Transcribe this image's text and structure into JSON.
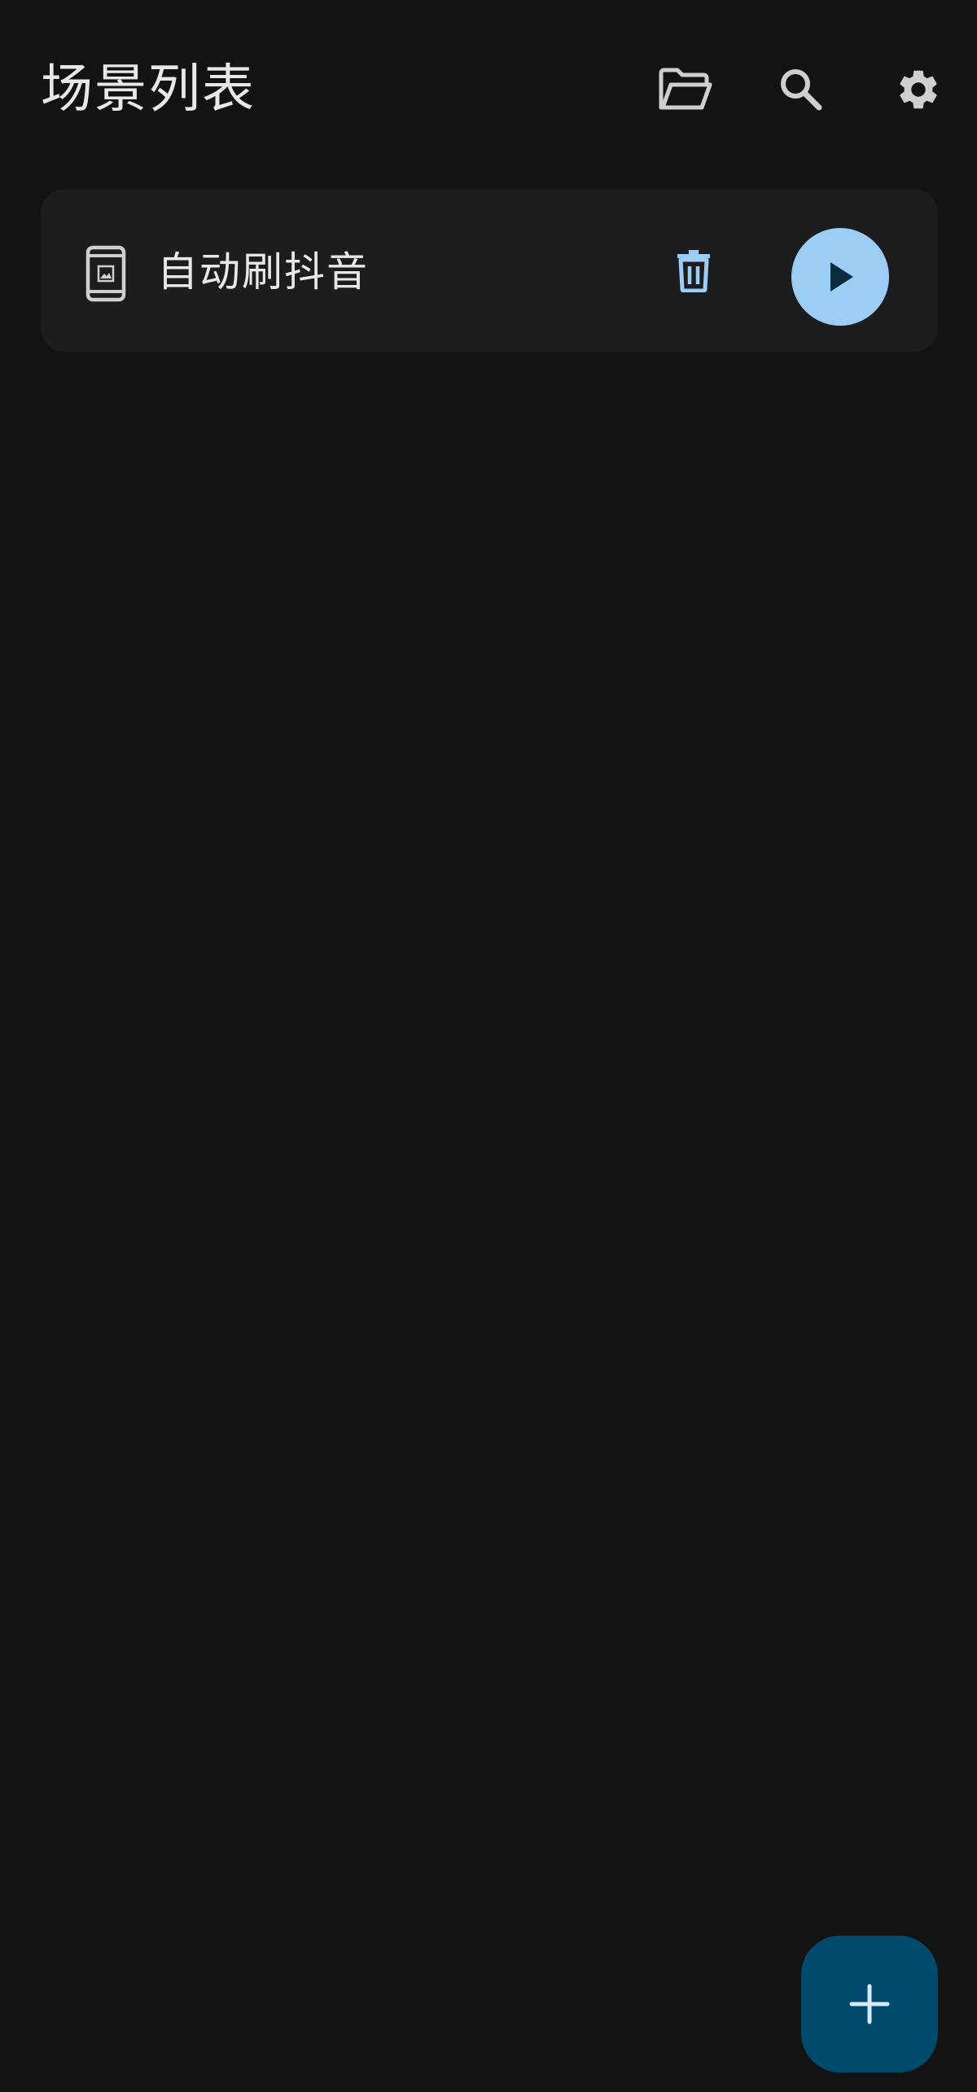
{
  "header": {
    "title": "场景列表",
    "actions": [
      {
        "name": "folder",
        "icon": "folder-open-icon"
      },
      {
        "name": "search",
        "icon": "search-icon"
      },
      {
        "name": "settings",
        "icon": "gear-icon"
      }
    ]
  },
  "scenes": [
    {
      "title": "自动刷抖音",
      "icon": "phone-screenshot-icon",
      "delete_icon": "trash-icon",
      "play_icon": "play-icon"
    }
  ],
  "fab": {
    "icon": "plus-icon"
  },
  "colors": {
    "background": "#131314",
    "card": "#1d1d1f",
    "accent": "#9ccdf5",
    "fab": "#004a6e",
    "icon": "#cfcfcf"
  }
}
